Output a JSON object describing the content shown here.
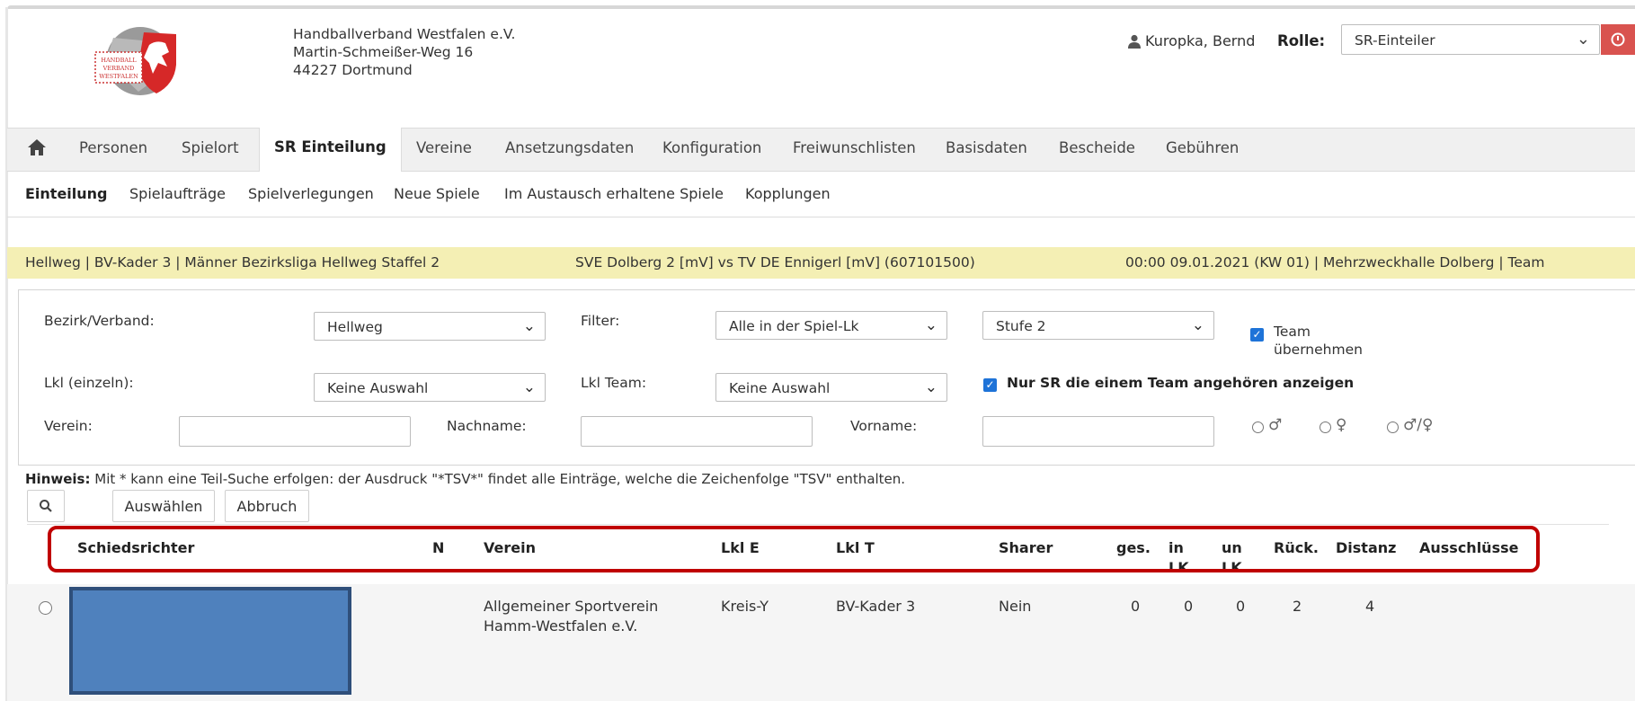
{
  "header": {
    "org_line1": "Handballverband Westfalen e.V.",
    "org_line2": "Martin-Schmeißer-Weg 16",
    "org_line3": "44227 Dortmund",
    "user_name": "Kuropka, Bernd",
    "role_label": "Rolle:",
    "role_value": "SR-Einteiler",
    "logo_text": "HANDBALL VERBAND WESTFALEN"
  },
  "main_nav": {
    "items": [
      "Personen",
      "Spielort",
      "SR Einteilung",
      "Vereine",
      "Ansetzungsdaten",
      "Konfiguration",
      "Freiwunschlisten",
      "Basisdaten",
      "Bescheide",
      "Gebühren"
    ],
    "active": "SR Einteilung"
  },
  "sub_nav": {
    "items": [
      "Einteilung",
      "Spielaufträge",
      "Spielverlegungen",
      "Neue Spiele",
      "Im Austausch erhaltene Spiele",
      "Kopplungen"
    ],
    "active": "Einteilung"
  },
  "info_bar": {
    "league": "Hellweg | BV-Kader 3 | Männer Bezirksliga Hellweg Staffel 2",
    "match": "SVE Dolberg 2 [mV] vs TV DE Ennigerl [mV] (607101500)",
    "datetime_venue": "00:00 09.01.2021 (KW 01) | Mehrzweckhalle Dolberg | Team"
  },
  "filters": {
    "bezirk_label": "Bezirk/Verband:",
    "bezirk_value": "Hellweg",
    "filter_label": "Filter:",
    "filter_value": "Alle in der Spiel-Lk",
    "stufe_value": "Stufe 2",
    "team_uebernehmen_label_1": "Team",
    "team_uebernehmen_label_2": "übernehmen",
    "team_uebernehmen_checked": true,
    "lkl_einzeln_label": "Lkl (einzeln):",
    "lkl_einzeln_value": "Keine Auswahl",
    "lkl_team_label": "Lkl Team:",
    "lkl_team_value": "Keine Auswahl",
    "nur_sr_team_label": "Nur SR die einem Team angehören anzeigen",
    "nur_sr_team_checked": true,
    "verein_label": "Verein:",
    "verein_value": "",
    "nachname_label": "Nachname:",
    "nachname_value": "",
    "vorname_label": "Vorname:",
    "vorname_value": "",
    "gender_male": "♂",
    "gender_female": "♀",
    "gender_both": "♂/♀"
  },
  "hint": {
    "bold": "Hinweis:",
    "text": " Mit * kann eine Teil-Suche erfolgen: der Ausdruck \"*TSV*\" findet alle Einträge, welche die Zeichenfolge \"TSV\" enthalten."
  },
  "toolbar": {
    "select_label": "Auswählen",
    "cancel_label": "Abbruch"
  },
  "table": {
    "columns": {
      "schiedsrichter": "Schiedsrichter",
      "n": "N",
      "verein": "Verein",
      "lkl_e": "Lkl E",
      "lkl_t": "Lkl T",
      "sharer": "Sharer",
      "ges": "ges.",
      "in_lk_1": "in",
      "in_lk_2": "LK",
      "un_lk_1": "un",
      "un_lk_2": "LK",
      "rueck": "Rück.",
      "distanz": "Distanz",
      "ausschluesse": "Ausschlüsse"
    },
    "rows": [
      {
        "schiedsrichter": "",
        "n": "",
        "verein_1": "Allgemeiner Sportverein",
        "verein_2": "Hamm-Westfalen e.V.",
        "lkl_e": "Kreis-Y",
        "lkl_t": "BV-Kader 3",
        "sharer": "Nein",
        "ges": "0",
        "in_lk": "0",
        "un_lk": "0",
        "rueck": "2",
        "distanz": "4",
        "ausschluesse": ""
      }
    ]
  },
  "colors": {
    "info_bar_bg": "#f4efb4",
    "highlight_border": "#c00000",
    "redaction": "#4f81bd",
    "checkbox": "#1e73d8",
    "logout": "#d9534f"
  }
}
